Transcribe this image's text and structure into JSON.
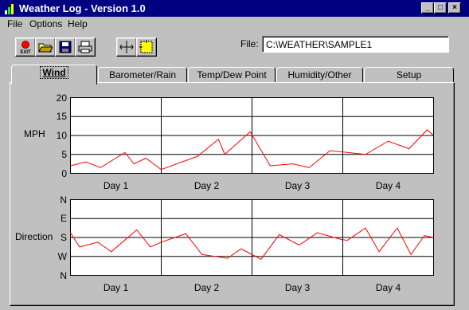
{
  "window": {
    "title": "Weather Log - Version 1.0",
    "controls": [
      "_",
      "□",
      "×"
    ]
  },
  "menu": [
    "File",
    "Options",
    "Help"
  ],
  "toolbar": {
    "buttons": [
      {
        "name": "exit-icon",
        "label": "EXIT"
      },
      {
        "name": "open-folder-icon",
        "label": ""
      },
      {
        "name": "save-disk-icon",
        "label": ""
      },
      {
        "name": "print-icon",
        "label": ""
      },
      {
        "name": "crosshair-icon",
        "label": ""
      },
      {
        "name": "zoom-select-icon",
        "label": ""
      }
    ]
  },
  "file": {
    "label": "File:",
    "value": "C:\\WEATHER\\SAMPLE1"
  },
  "tabs": [
    {
      "label": "Wind",
      "active": true
    },
    {
      "label": "Barometer/Rain",
      "active": false
    },
    {
      "label": "Temp/Dew Point",
      "active": false
    },
    {
      "label": "Humidity/Other",
      "active": false
    },
    {
      "label": "Setup",
      "active": false
    }
  ],
  "chart_data": [
    {
      "type": "line",
      "ylabel": "MPH",
      "yticks": [
        "20",
        "15",
        "10",
        "5",
        "0"
      ],
      "ylim": [
        0,
        20
      ],
      "categories": [
        "Day 1",
        "Day 2",
        "Day 3",
        "Day 4"
      ],
      "xlim": [
        0,
        4
      ],
      "grid": true,
      "line_color": "#ff0000",
      "series": [
        {
          "x": [
            0,
            0.17,
            0.33,
            0.6,
            0.7,
            0.83,
            1.0,
            1.4,
            1.63,
            1.7,
            1.98,
            2.2,
            2.45,
            2.63,
            2.86,
            3.25,
            3.5,
            3.73,
            3.93,
            4.0
          ],
          "values": [
            2,
            3,
            1.5,
            5.5,
            2.5,
            4,
            1,
            4.5,
            9,
            5,
            11,
            2,
            2.5,
            1.5,
            6,
            5,
            8.5,
            6.5,
            11.5,
            10
          ]
        }
      ]
    },
    {
      "type": "line",
      "ylabel": "Direction",
      "yticks": [
        "N",
        "E",
        "S",
        "W",
        "N"
      ],
      "ylim": [
        0,
        4
      ],
      "categories": [
        "Day 1",
        "Day 2",
        "Day 3",
        "Day 4"
      ],
      "xlim": [
        0,
        4
      ],
      "grid": true,
      "line_color": "#ff0000",
      "series": [
        {
          "x": [
            0,
            0.1,
            0.3,
            0.45,
            0.73,
            0.88,
            1.0,
            1.27,
            1.45,
            1.73,
            1.88,
            2.1,
            2.3,
            2.52,
            2.72,
            2.98,
            3.05,
            3.25,
            3.4,
            3.6,
            3.75,
            3.9,
            4.0
          ],
          "values": [
            2.25,
            1.5,
            1.75,
            1.25,
            2.4,
            1.5,
            1.75,
            2.2,
            1.1,
            0.9,
            1.4,
            0.85,
            2.15,
            1.6,
            2.25,
            1.9,
            1.85,
            2.5,
            1.25,
            2.5,
            1.1,
            2.1,
            2
          ]
        }
      ]
    }
  ]
}
